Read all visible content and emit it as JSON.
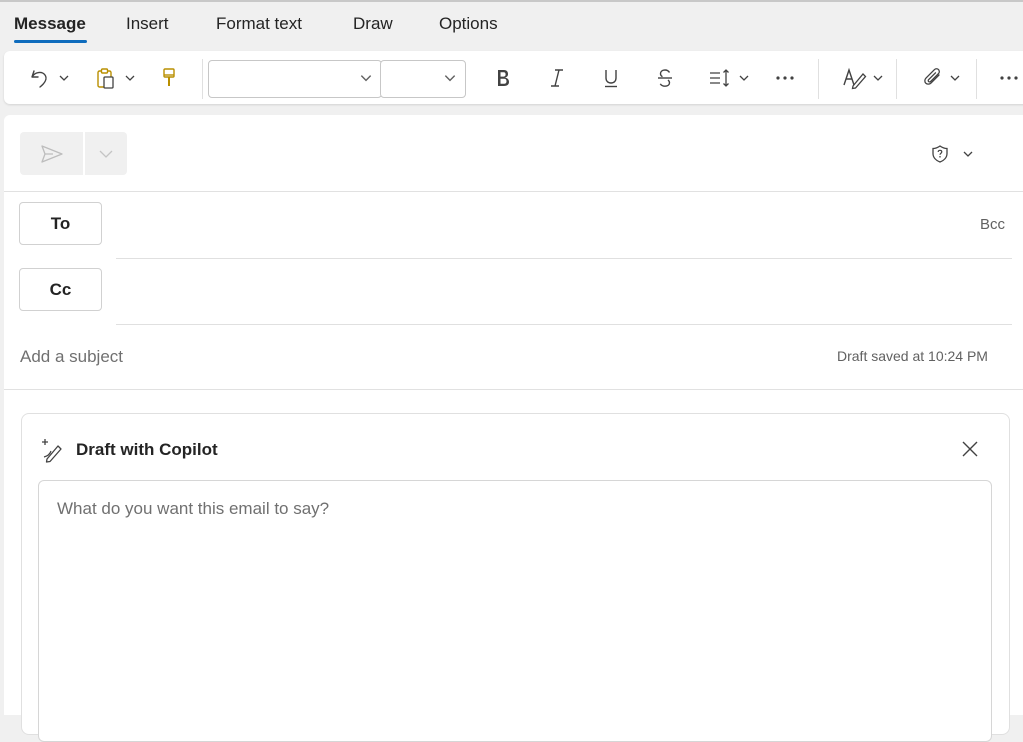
{
  "ribbon": {
    "tabs": [
      {
        "label": "Message",
        "active": true
      },
      {
        "label": "Insert",
        "active": false
      },
      {
        "label": "Format text",
        "active": false
      },
      {
        "label": "Draw",
        "active": false
      },
      {
        "label": "Options",
        "active": false
      }
    ],
    "accent_color": "#0f6cbd"
  },
  "toolbar": {
    "icons": [
      "undo-icon",
      "paste-icon",
      "format-painter-icon",
      "bold-icon",
      "italic-icon",
      "underline-icon",
      "strikethrough-icon",
      "paragraph-icon",
      "more-options-icon",
      "signature-icon",
      "attach-icon",
      "overflow-icon"
    ],
    "font_name_value": "",
    "font_size_value": ""
  },
  "compose": {
    "to_label": "To",
    "cc_label": "Cc",
    "bcc_label": "Bcc",
    "subject_placeholder": "Add a subject",
    "draft_status": "Draft saved at 10:24 PM"
  },
  "copilot": {
    "title": "Draft with Copilot",
    "prompt_placeholder": "What do you want this email to say?"
  }
}
